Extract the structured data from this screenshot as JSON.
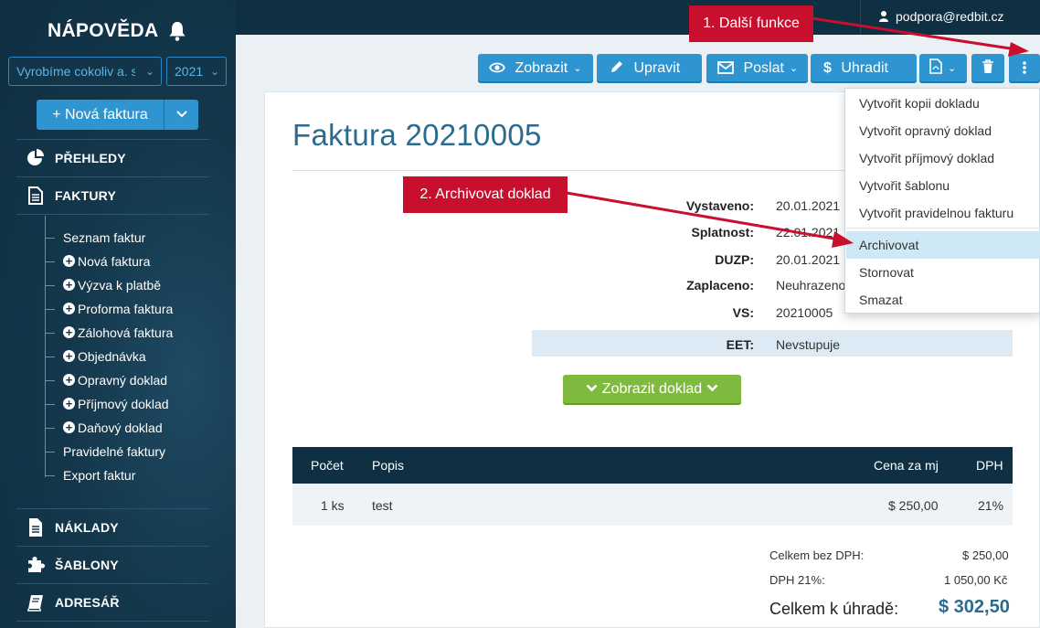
{
  "sidebar": {
    "brand": "NÁPOVĚDA",
    "company_select": "Vyrobíme cokoliv a. s.",
    "year_select": "2021",
    "new_invoice_button": "+ Nová faktura",
    "nav": {
      "prehledy": "PŘEHLEDY",
      "faktury": "FAKTURY",
      "naklady": "NÁKLADY",
      "sablony": "ŠABLONY",
      "adresar": "ADRESÁŘ"
    },
    "sub_items": [
      {
        "label": "Seznam faktur",
        "plus": false
      },
      {
        "label": "Nová faktura",
        "plus": true
      },
      {
        "label": "Výzva k platbě",
        "plus": true
      },
      {
        "label": "Proforma faktura",
        "plus": true
      },
      {
        "label": "Zálohová faktura",
        "plus": true
      },
      {
        "label": "Objednávka",
        "plus": true
      },
      {
        "label": "Opravný doklad",
        "plus": true
      },
      {
        "label": "Příjmový doklad",
        "plus": true
      },
      {
        "label": "Daňový doklad",
        "plus": true
      },
      {
        "label": "Pravidelné faktury",
        "plus": false
      },
      {
        "label": "Export faktur",
        "plus": false
      }
    ]
  },
  "topbar": {
    "user": "podpora@redbit.cz"
  },
  "toolbar": {
    "zobrazit": "Zobrazit",
    "upravit": "Upravit",
    "poslat": "Poslat",
    "uhradit": "Uhradit"
  },
  "document": {
    "title": "Faktura 20210005",
    "fields": [
      {
        "key": "Vystaveno:",
        "value": "20.01.2021"
      },
      {
        "key": "Splatnost:",
        "value": "22.01.2021"
      },
      {
        "key": "DUZP:",
        "value": "20.01.2021"
      },
      {
        "key": "Zaplaceno:",
        "value": "Neuhrazeno"
      },
      {
        "key": "VS:",
        "value": "20210005"
      },
      {
        "key": "EET:",
        "value": "Nevstupuje"
      }
    ],
    "show_document_button": "Zobrazit doklad"
  },
  "items_table": {
    "headers": [
      "Počet",
      "Popis",
      "Cena za mj",
      "DPH"
    ],
    "rows": [
      [
        "1 ks",
        "test",
        "$ 250,00",
        "21%"
      ]
    ]
  },
  "totals": {
    "without_vat_label": "Celkem bez DPH:",
    "without_vat_value": "$ 250,00",
    "vat_label": "DPH 21%:",
    "vat_value": "1 050,00 Kč",
    "total_label": "Celkem k úhradě:",
    "total_value": "$ 302,50"
  },
  "more_menu": {
    "items": [
      "Vytvořit kopii dokladu",
      "Vytvořit opravný doklad",
      "Vytvořit příjmový doklad",
      "Vytvořit šablonu",
      "Vytvořit pravidelnou fakturu",
      "Archivovat",
      "Stornovat",
      "Smazat"
    ],
    "active_item": "Archivovat"
  },
  "callouts": {
    "step1": "1. Další funkce",
    "step2": "2. Archivovat doklad",
    "color": "#c8102e"
  },
  "colors": {
    "sidebar": "#14374b",
    "primary_button": "#2f95d1",
    "green_button": "#7fba3f",
    "title_blue": "#2a6b8f"
  }
}
